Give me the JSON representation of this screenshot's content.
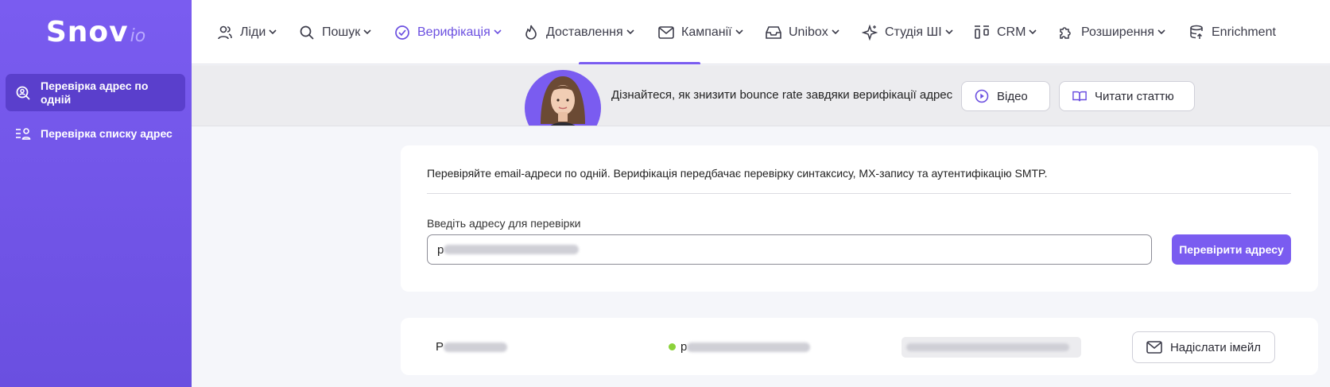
{
  "brand": {
    "logo_main": "Snov",
    "logo_sub": "io"
  },
  "sidebar": {
    "items": [
      {
        "label": "Перевірка адрес по одній",
        "icon": "search-user-icon",
        "active": true
      },
      {
        "label": "Перевірка списку адрес",
        "icon": "list-user-icon",
        "active": false
      }
    ]
  },
  "nav": {
    "items": [
      {
        "label": "Ліди",
        "icon": "users-icon",
        "dropdown": true
      },
      {
        "label": "Пошук",
        "icon": "search-icon",
        "dropdown": true
      },
      {
        "label": "Верифікація",
        "icon": "check-circle-icon",
        "dropdown": true,
        "active": true
      },
      {
        "label": "Доставлення",
        "icon": "flame-icon",
        "dropdown": true
      },
      {
        "label": "Кампанії",
        "icon": "mail-icon",
        "dropdown": true
      },
      {
        "label": "Unibox",
        "icon": "inbox-icon",
        "dropdown": true
      },
      {
        "label": "Студія ШІ",
        "icon": "sparkle-icon",
        "dropdown": true
      },
      {
        "label": "CRM",
        "icon": "kanban-icon",
        "dropdown": true
      },
      {
        "label": "Розширення",
        "icon": "puzzle-icon",
        "dropdown": true
      },
      {
        "label": "Enrichment",
        "icon": "database-icon",
        "dropdown": false
      }
    ]
  },
  "banner": {
    "text": "Дізнайтеся, як знизити bounce rate завдяки верифікації адрес",
    "video_label": "Відео",
    "article_label": "Читати статтю"
  },
  "verify": {
    "description": "Перевіряйте email-адреси по одній. Верифікація передбачає перевірку синтаксису, MX-запису та аутентифікацію SMTP.",
    "input_label": "Введіть адресу для перевірки",
    "input_value_prefix": "p",
    "submit_label": "Перевірити адресу"
  },
  "result": {
    "name_prefix": "P",
    "email_prefix": "p",
    "status_color": "#8bd23a",
    "send_label": "Надіслати імейл"
  },
  "colors": {
    "accent": "#7a5cf0",
    "sidebar": "#6a4fe0"
  }
}
